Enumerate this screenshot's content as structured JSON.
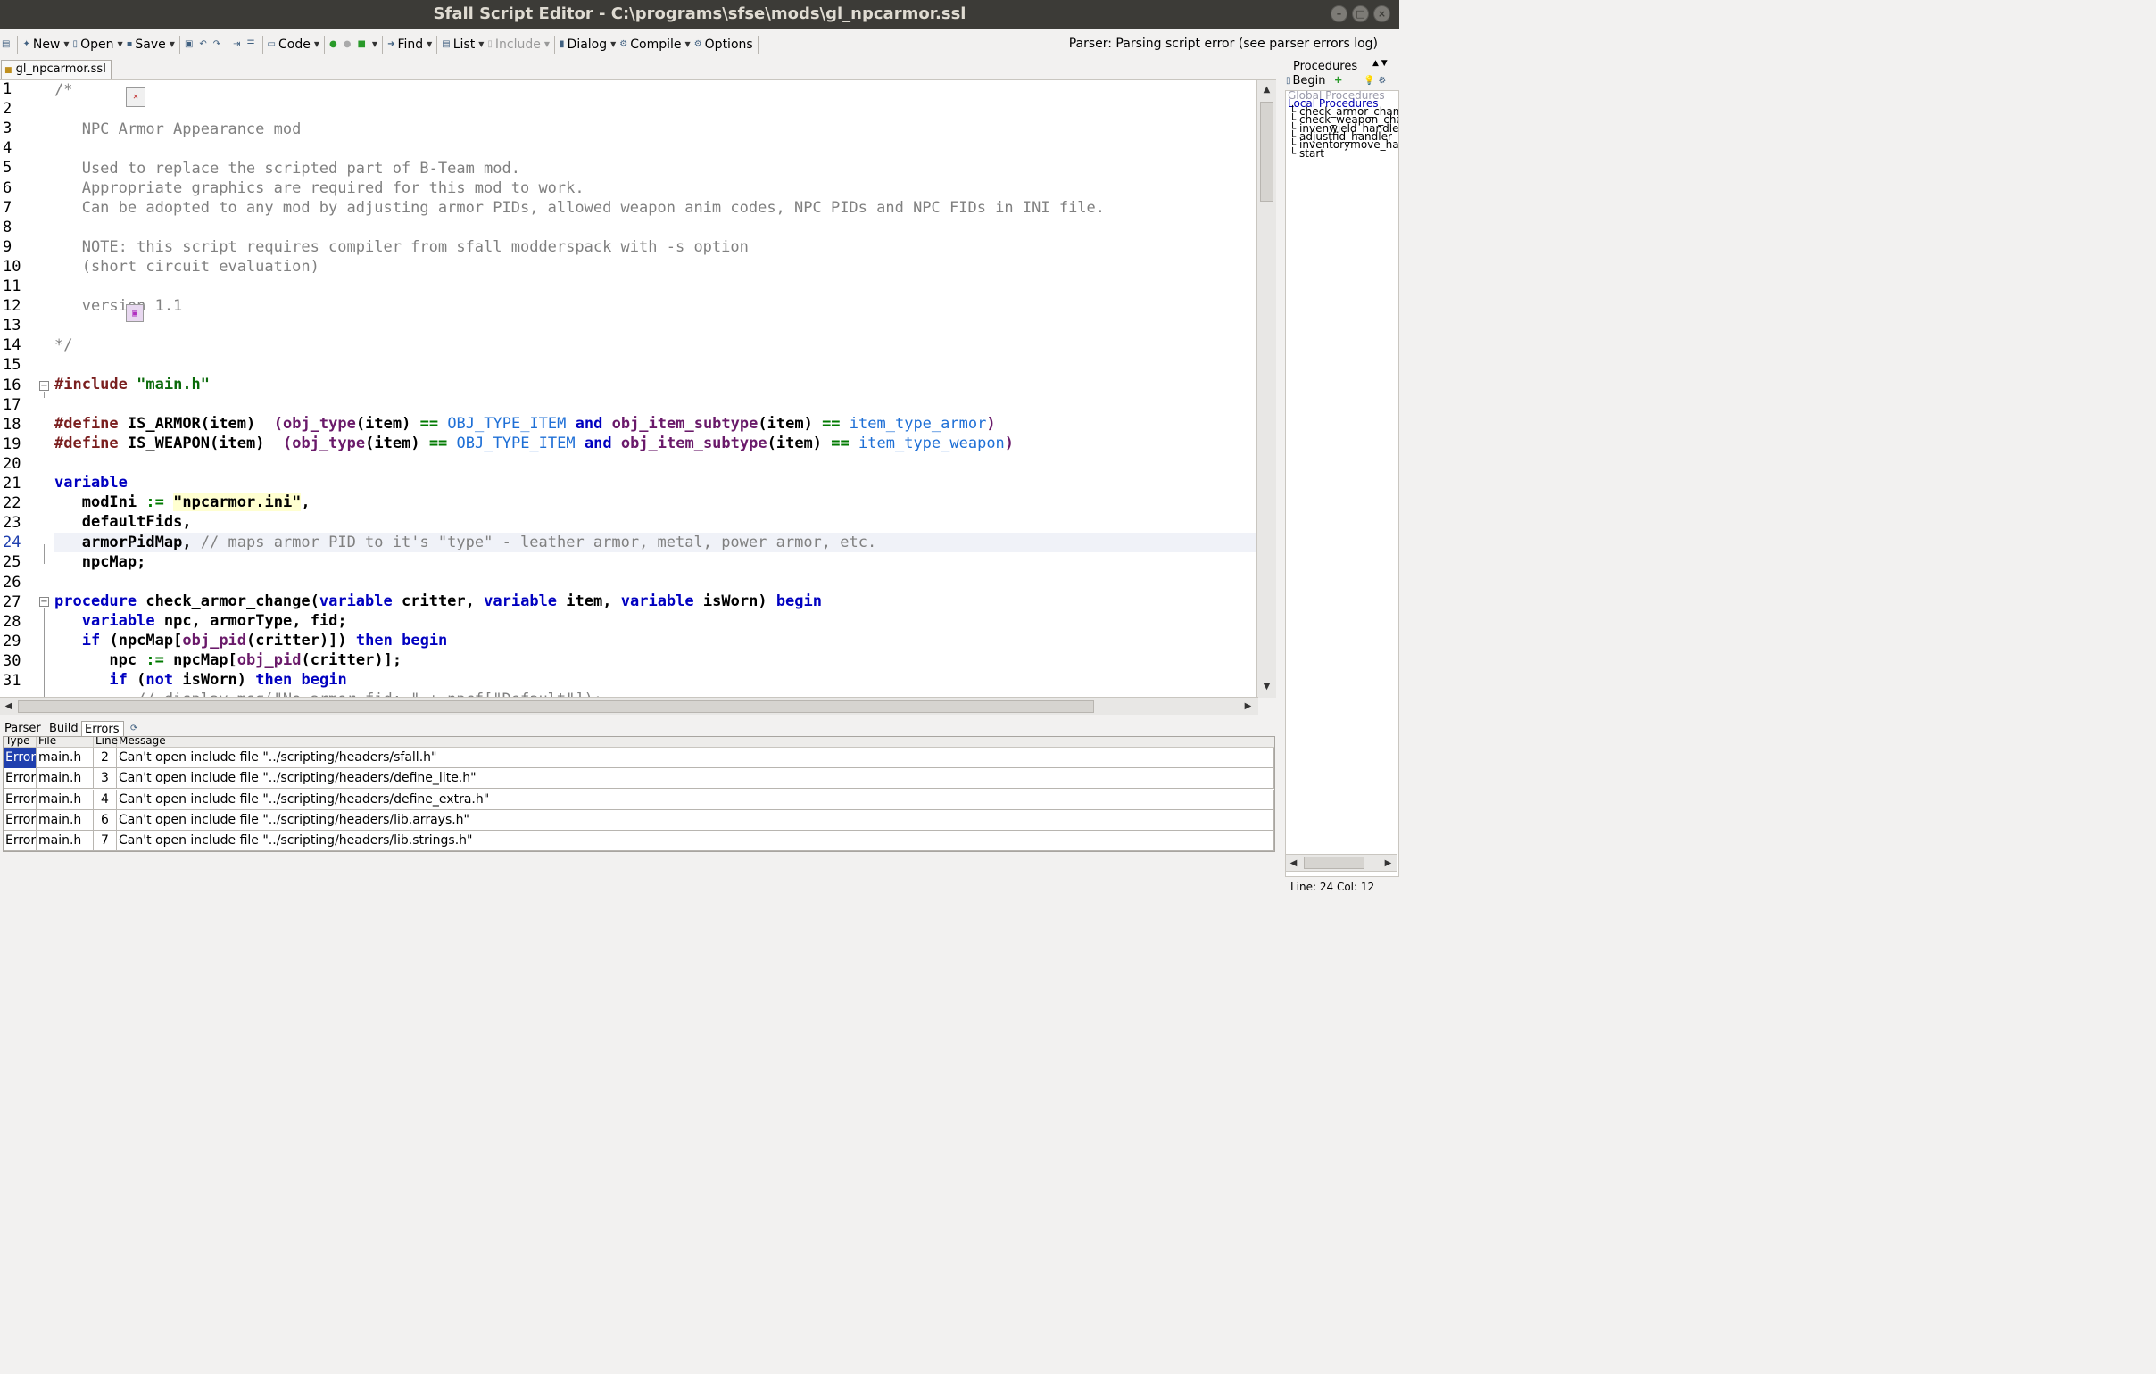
{
  "window": {
    "title": "Sfall Script Editor - C:\\programs\\sfse\\mods\\gl_npcarmor.ssl"
  },
  "toolbar": {
    "new": "New",
    "open": "Open",
    "save": "Save",
    "code": "Code",
    "find": "Find",
    "list": "List",
    "include": "Include",
    "dialog": "Dialog",
    "compile": "Compile",
    "options": "Options",
    "parser_status": "Parser: Parsing script error (see parser errors log)"
  },
  "editor": {
    "tab": "gl_npcarmor.ssl",
    "current_line": 24,
    "line_numbers": [
      "1",
      "2",
      "3",
      "4",
      "5",
      "6",
      "7",
      "8",
      "9",
      "10",
      "11",
      "12",
      "13",
      "14",
      "15",
      "16",
      "17",
      "18",
      "19",
      "20",
      "21",
      "22",
      "23",
      "24",
      "25",
      "26",
      "27",
      "28",
      "29",
      "30",
      "31"
    ],
    "code_text": {
      "l1": "/*",
      "l3": "   NPC Armor Appearance mod",
      "l5": "   Used to replace the scripted part of B-Team mod.",
      "l6": "   Appropriate graphics are required for this mod to work.",
      "l7": "   Can be adopted to any mod by adjusting armor PIDs, allowed weapon anim codes, NPC PIDs and NPC FIDs in INI file.",
      "l9": "   NOTE: this script requires compiler from sfall modderspack with -s option",
      "l10": "   (short circuit evaluation)",
      "l12": "   version 1.1",
      "l14": "*/",
      "inc_kw": "#include",
      "inc_file": "\"main.h\"",
      "def_kw": "#define",
      "is_armor": "IS_ARMOR",
      "is_weapon": "IS_WEAPON",
      "obj_type": "obj_type",
      "item": "item",
      "obj_type_item": "OBJ_TYPE_ITEM",
      "and": "and",
      "obj_item_subtype": "obj_item_subtype",
      "item_type_armor": "item_type_armor",
      "item_type_weapon": "item_type_weapon",
      "eqeq": "==",
      "variable": "variable",
      "modini": "modIni",
      "assign": ":=",
      "modini_val": "\"npcarmor.ini\"",
      "defaultfids": "defaultFids",
      "armorpidmap": "armorPidMap",
      "armorpidmap_comment": "// maps armor PID to it's \"type\" - leather armor, metal, power armor, etc.",
      "npcmap": "npcMap",
      "procedure": "procedure",
      "check_armor_change": "check_armor_change",
      "critter": "critter",
      "isworn": "isWorn",
      "begin": "begin",
      "npc": "npc",
      "armortype": "armorType",
      "fid": "fid",
      "if": "if",
      "then": "then",
      "obj_pid": "obj_pid",
      "not": "not",
      "l32": "         // display_msg(\"No armor fid: \" + npcf[\"Default\"]);"
    }
  },
  "bottom_panel": {
    "tabs": [
      "Parser",
      "Build",
      "Errors"
    ],
    "active_tab": "Errors",
    "columns": [
      "Type",
      "File",
      "Line",
      "Message"
    ],
    "rows": [
      {
        "type": "Error",
        "file": "main.h",
        "line": "2",
        "message": "Can't open include file \"../scripting/headers/sfall.h\""
      },
      {
        "type": "Error",
        "file": "main.h",
        "line": "3",
        "message": "Can't open include file \"../scripting/headers/define_lite.h\""
      },
      {
        "type": "Error",
        "file": "main.h",
        "line": "4",
        "message": "Can't open include file \"../scripting/headers/define_extra.h\""
      },
      {
        "type": "Error",
        "file": "main.h",
        "line": "6",
        "message": "Can't open include file \"../scripting/headers/lib.arrays.h\""
      },
      {
        "type": "Error",
        "file": "main.h",
        "line": "7",
        "message": "Can't open include file \"../scripting/headers/lib.strings.h\""
      }
    ]
  },
  "procedures_panel": {
    "title": "Procedures",
    "begin_button": "Begin",
    "global_group": "Global Procedures",
    "local_group": "Local Procedures",
    "items": [
      "check_armor_change",
      "check_weapon_change",
      "invenwield_handler",
      "adjustfid_handler",
      "inventorymove_handler",
      "start"
    ]
  },
  "status": {
    "cursor": "Line: 24 Col: 12"
  },
  "colors": {
    "keyword": "#0000c0",
    "preprocessor": "#7a1f1f",
    "function": "#6a1a6a",
    "constant": "#1e6fd6",
    "comment": "#808080",
    "error_select": "#1f3fae"
  }
}
